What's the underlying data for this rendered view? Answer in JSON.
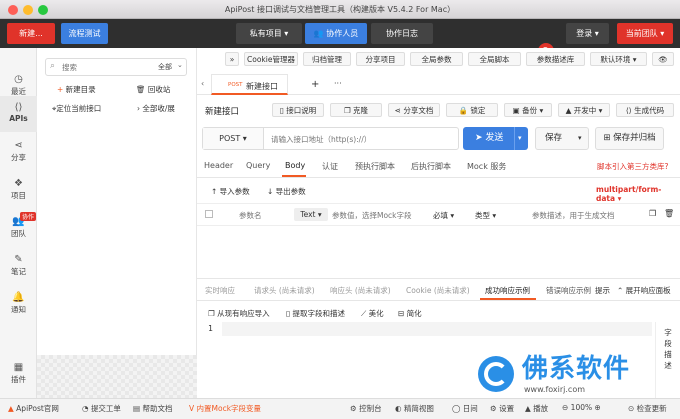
{
  "window": {
    "title": "ApiPost 接口调试与文档管理工具（构建版本 V5.4.2 For Mac）"
  },
  "topbar": {
    "new_btn": "新建...",
    "flow_btn": "流程测试",
    "private_project": "私有项目 ▾",
    "collaborators": "协作人员",
    "collab_log": "协作日志",
    "login": "登录 ▾",
    "current_team": "当前团队 ▾"
  },
  "sidebar": {
    "items": [
      {
        "label": "最近"
      },
      {
        "label": "APIs"
      },
      {
        "label": "分享"
      },
      {
        "label": "项目"
      },
      {
        "label": "团队",
        "badge": "协作"
      },
      {
        "label": "笔记"
      },
      {
        "label": "通知"
      },
      {
        "label": "插件"
      }
    ]
  },
  "panel": {
    "search_placeholder": "搜索",
    "search_scope": "全部",
    "new_dir": "新建目录",
    "recycle": "回收站",
    "locate": "定位当前接口",
    "collapse": "全部收/展"
  },
  "toolbar": {
    "items": [
      "»",
      "Cookie管理器",
      "归档管理",
      "分享项目",
      "全局参数",
      "全局脚本",
      "参数描述库",
      "默认环境 ▾",
      "👁"
    ]
  },
  "doc_tab": {
    "method": "POST",
    "label": "新建接口",
    "add": "+",
    "more": "···"
  },
  "api": {
    "name": "新建接口",
    "actions": [
      "接口说明",
      "克隆",
      "分享文档",
      "锁定",
      "备份 ▾",
      "开发中 ▾",
      "生成代码"
    ],
    "method": "POST ▾",
    "url_placeholder": "请输入接口地址（http(s)://）",
    "send": "发送",
    "save": "保存",
    "save_archive": "保存并归档"
  },
  "req_tabs": [
    "Header",
    "Query",
    "Body",
    "认证",
    "预执行脚本",
    "后执行脚本",
    "Mock 服务"
  ],
  "req_tabs_active": "Body",
  "third_party_link": "脚本引入第三方类库?",
  "body": {
    "import_params": "导入参数",
    "export_params": "导出参数",
    "content_type": "multipart/form-data ▾",
    "param_name_placeholder": "参数名",
    "type_select": "Text ▾",
    "param_value_placeholder": "参数值，选择Mock字段",
    "required": "必填 ▾",
    "type": "类型 ▾",
    "desc_placeholder": "参数描述，用于生成文档"
  },
  "resp_tabs": [
    "实时响应",
    "请求头 (尚未请求)",
    "响应头 (尚未请求)",
    "Cookie (尚未请求)",
    "成功响应示例",
    "错误响应示例"
  ],
  "resp_tabs_active": "成功响应示例",
  "resp_extra": {
    "hint": "提示",
    "expand": "展开响应面板"
  },
  "resp_tools": [
    "从现有响应导入",
    "提取字段和描述",
    "美化",
    "简化"
  ],
  "editor": {
    "line_no": "1"
  },
  "field_desc": [
    "字",
    "段",
    "描",
    "述"
  ],
  "statusbar": {
    "left": [
      "ApiPost官网",
      "提交工单",
      "帮助文档",
      "内置Mock字段变量"
    ],
    "right": [
      "控制台",
      "精简视图",
      "日间",
      "设置",
      "播放",
      "100%",
      "检查更新"
    ]
  },
  "watermark": {
    "text": "佛系软件",
    "url": "www.foxirj.com"
  },
  "colors": {
    "accent": "#f15a24",
    "blue": "#3b7fe0",
    "topbar": "#2f2f2f",
    "red_btn": "#e0332a"
  }
}
